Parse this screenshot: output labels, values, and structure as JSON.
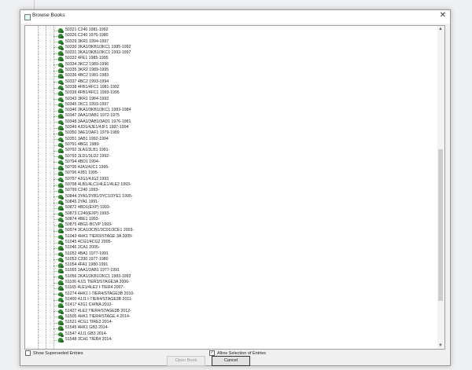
{
  "dialog": {
    "title": "Browse Books"
  },
  "entries": [
    "50321 C240 1981-1992",
    "50326 C240 1976-1980",
    "50329 3KR1 1994-1997",
    "50330 3KA1/3KB1/3KC1 1985-1992",
    "50331 3KA1/3KB1/3KC1 1993-1997",
    "50332 4FE1 1985-1995",
    "50334 3KC2 1989-1996",
    "50335 3KR2 1989-1995",
    "50336 4BC2 1981-1983",
    "50337 4BC2 1993-1994",
    "50338 4FB1/4FC1 1981-1992",
    "50339 4FB1/4FC1 1993-1995",
    "50343 3KR1 1984-1993",
    "50345 2KC1 1993-1997",
    "50346 3KA1/3KB1/3KC1 1983-1984",
    "50347 3AA1/3AB1 1972-1975",
    "50348 3AA1/3AB1/3AD1 1976-1981",
    "50349 4JD1/4JE1/4JF1 1987-1994",
    "50350 3AE1/3AF1 1979-1989",
    "50351 3AB1 1992-1994",
    "50791 4BG1 1989-",
    "50792 3LA1/3LB1 1991-",
    "50793 3LD1/3LD2 1992-",
    "50794 4BD1 1994-",
    "50795 4JA1/4JC1 1995-",
    "50796 4JB1 1995-",
    "50797 4JG1/4JG2 1993",
    "50798 4LB1/4LC1/4LE1/4LE2 1993-",
    "50799 C240 1993-",
    "50844 3YA1/3YB1/3YC1/3YE1 1995-",
    "50845 2YA1 1991-",
    "50872 4BD1(EXP) 1993-",
    "50873 C240(EXP) 1993-",
    "50874 4BE1 1993-",
    "50875 4BG1-BCVP 1993-",
    "50974 3CA1/3CB1/3CD1/3CE1 2003-",
    "51043 4HK1 TIER3/STAGE 3A 2005-",
    "51045 4CG1/4CG2 2005-",
    "51046 2CA1 2005-",
    "51052 4BA1 1977-1991",
    "51053 C330 1977-1980",
    "51054 4FA1 1980-1991",
    "51055 2AA1/2AB1 1977-1991",
    "51056 2KA1/2KB1/2KC1 1983-1993",
    "51106 4JJ1 TIER3/STAGE3A 2006-",
    "51165 4LE1/4LE2 I-TIER4 2007-",
    "51274 4HK1 I-TIER4/STAGE3B 2010-",
    "51400 4JJ1 I-TIER4/STAGE3B 2011-",
    "51417 4JG1 CHINA 2012-",
    "51427 4LE2 TIER4/STAGE3B 2012-",
    "51505 4HK1 TIER4/STAGE 4 2014-",
    "51521 4CG1 TIRE3 2014-",
    "51545 4HK1 GB3 2014-",
    "51547 4JJ1 GB3 2014-",
    "51548 3CH1 TIER4 2014-"
  ],
  "options": {
    "show_superseded_label": "Show Superseded Entries",
    "show_superseded_checked": false,
    "allow_selection_label": "Allow Selection of Entries",
    "allow_selection_checked": true
  },
  "buttons": {
    "open_book": "Open Book",
    "cancel": "Cancel"
  },
  "scroll": {
    "position_fraction": 0.4,
    "visible_fraction": 0.47
  }
}
